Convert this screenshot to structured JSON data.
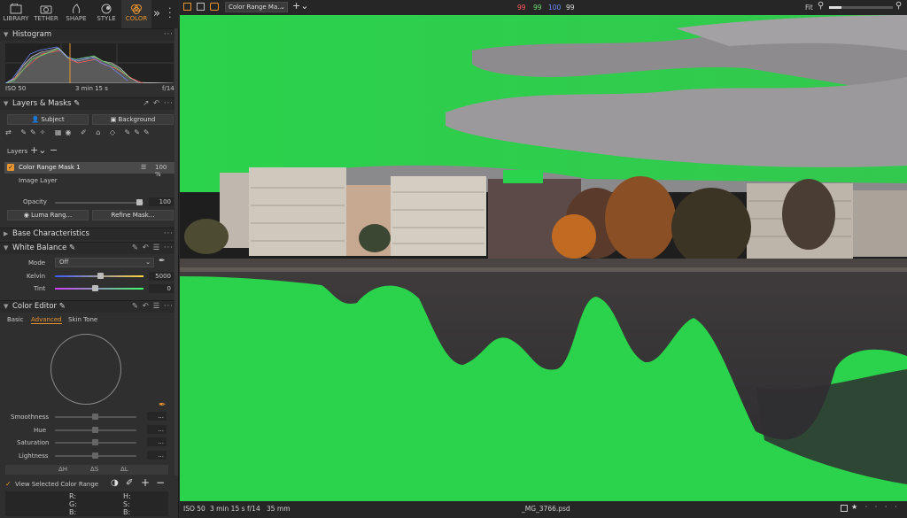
{
  "tabs": [
    {
      "label": "LIBRARY",
      "icon": "library-icon"
    },
    {
      "label": "TETHER",
      "icon": "tether-icon"
    },
    {
      "label": "SHAPE",
      "icon": "shape-icon"
    },
    {
      "label": "STYLE",
      "icon": "style-icon"
    },
    {
      "label": "COLOR",
      "icon": "color-icon"
    }
  ],
  "histogram": {
    "title": "Histogram",
    "iso": "ISO 50",
    "shutter": "3 min 15 s",
    "aperture": "f/14"
  },
  "layers_masks": {
    "title": "Layers & Masks",
    "subject_label": "Subject",
    "background_label": "Background",
    "layers_label": "Layers",
    "layer_name": "Color Range Mask 1",
    "layer_opacity": "100 %",
    "image_layer": "Image Layer",
    "opacity_label": "Opacity",
    "opacity_value": "100",
    "opacity_fraction": 1.0,
    "luma_label": "Luma Rang...",
    "refine_label": "Refine Mask..."
  },
  "base_characteristics": {
    "title": "Base Characteristics"
  },
  "white_balance": {
    "title": "White Balance",
    "mode_label": "Mode",
    "mode_value": "Off",
    "kelvin_label": "Kelvin",
    "kelvin_value": "5000",
    "tint_label": "Tint",
    "tint_value": "0"
  },
  "color_editor": {
    "title": "Color Editor",
    "tabs": [
      "Basic",
      "Advanced",
      "Skin Tone"
    ],
    "active_tab": "Advanced",
    "sliders": [
      {
        "label": "Smoothness",
        "value": "..."
      },
      {
        "label": "Hue",
        "value": "..."
      },
      {
        "label": "Saturation",
        "value": "..."
      },
      {
        "label": "Lightness",
        "value": "..."
      }
    ],
    "delta_h": "ΔH",
    "delta_s": "ΔS",
    "delta_l": "ΔL",
    "view_selected": "View Selected Color Range",
    "readout": {
      "r": "R:",
      "g": "G:",
      "b": "B:",
      "h": "H:",
      "s": "S:",
      "b2": "B:"
    }
  },
  "topbar": {
    "mask_dropdown": "Color Range Ma...",
    "rgb": [
      "99",
      "99",
      "100",
      "99"
    ],
    "zoom_label": "Fit"
  },
  "status": {
    "iso": "ISO 50",
    "shutter": "3 min 15 s",
    "aperture": "f/14",
    "focal": "35 mm",
    "filename": "_MG_3766.psd"
  },
  "colors": {
    "accent": "#e8942f",
    "mask_green": "#2bd24b",
    "r": "#ff5a5a",
    "g": "#6ddf6d",
    "b": "#6f8cff"
  }
}
